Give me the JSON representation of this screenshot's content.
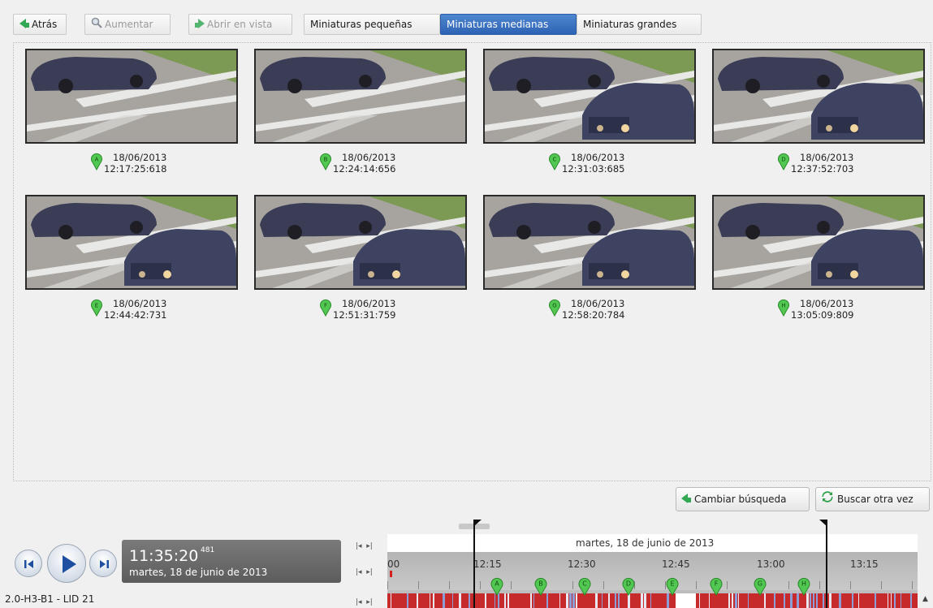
{
  "toolbar": {
    "back_label": "Atrás",
    "zoom_label": "Aumentar",
    "open_view_label": "Abrir en vista",
    "tabs": [
      {
        "label": "Miniaturas pequeñas",
        "active": false
      },
      {
        "label": "Miniaturas medianas",
        "active": true
      },
      {
        "label": "Miniaturas grandes",
        "active": false
      }
    ]
  },
  "thumbnails": [
    {
      "marker": "A",
      "date": "18/06/2013",
      "time": "12:17:25:618"
    },
    {
      "marker": "B",
      "date": "18/06/2013",
      "time": "12:24:14:656"
    },
    {
      "marker": "C",
      "date": "18/06/2013",
      "time": "12:31:03:685"
    },
    {
      "marker": "D",
      "date": "18/06/2013",
      "time": "12:37:52:703"
    },
    {
      "marker": "E",
      "date": "18/06/2013",
      "time": "12:44:42:731"
    },
    {
      "marker": "F",
      "date": "18/06/2013",
      "time": "12:51:31:759"
    },
    {
      "marker": "G",
      "date": "18/06/2013",
      "time": "12:58:20:784"
    },
    {
      "marker": "H",
      "date": "18/06/2013",
      "time": "13:05:09:809"
    }
  ],
  "actions": {
    "change_search_label": "Cambiar búsqueda",
    "search_again_label": "Buscar otra vez"
  },
  "playback": {
    "time": "11:35:20",
    "ms": "481",
    "date": "martes, 18 de junio de 2013"
  },
  "camera_label": "2.0-H3-B1 - LID 21",
  "timeline": {
    "date_label": "martes, 18 de junio de 2013",
    "first_tick_partial": ":00",
    "ticks": [
      "12:15",
      "12:30",
      "12:45",
      "13:00",
      "13:15"
    ],
    "markers": [
      "A",
      "B",
      "C",
      "D",
      "E",
      "F",
      "G",
      "H"
    ]
  },
  "colors": {
    "accent_tab": "#2d63b4",
    "marker_green": "#3fbf3f",
    "recording_red": "#c62a2a",
    "motion_blue": "#8c9ed8"
  },
  "icons": {
    "back": "arrow-left-icon",
    "zoom": "magnifier-icon",
    "open_view": "arrow-right-icon",
    "change_search": "arrow-left-icon",
    "search_again": "refresh-icon"
  }
}
